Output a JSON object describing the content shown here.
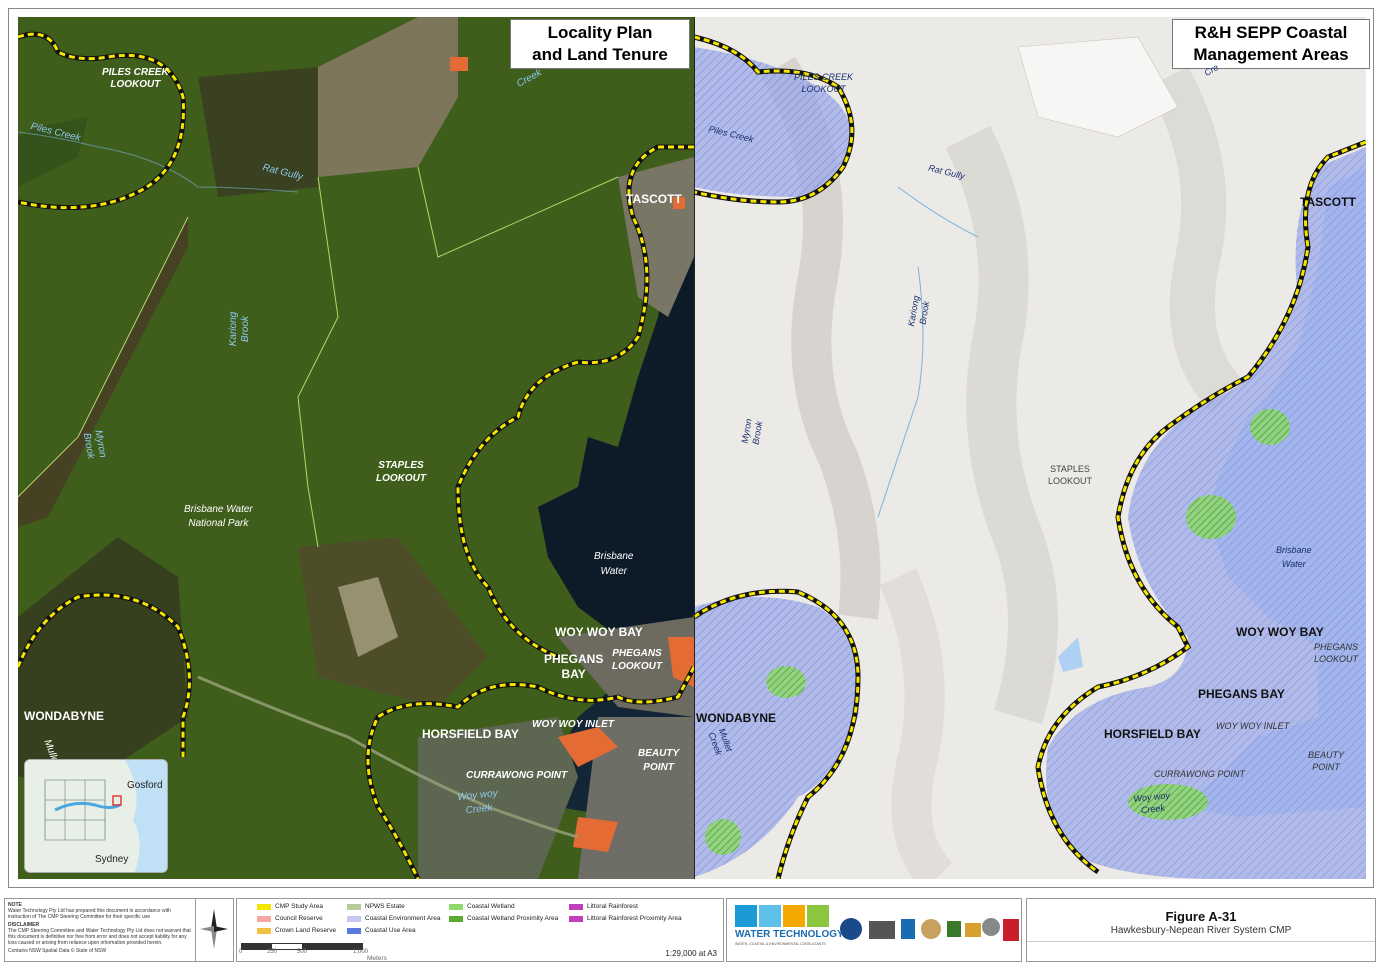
{
  "left_panel": {
    "title_line1": "Locality Plan",
    "title_line2": "and Land Tenure",
    "labels": {
      "piles_creek_lookout_1": "PILES CREEK",
      "piles_creek_lookout_2": "LOOKOUT",
      "piles_creek": "Piles Creek",
      "rat_gully": "Rat Gully",
      "coorumbine_creek": "Creek",
      "kariong_brook_1": "Kariong",
      "kariong_brook_2": "Brook",
      "myron_brook_1": "Myron",
      "myron_brook_2": "Brook",
      "staples_lookout_1": "STAPLES",
      "staples_lookout_2": "LOOKOUT",
      "national_park_1": "Brisbane Water",
      "national_park_2": "National Park",
      "tascott": "TASCOTT",
      "brisbane_water_1": "Brisbane",
      "brisbane_water_2": "Water",
      "woy_woy_bay": "WOY WOY BAY",
      "phegans_bay_1": "PHEGANS",
      "phegans_bay_2": "BAY",
      "phegans_lookout_1": "PHEGANS",
      "phegans_lookout_2": "LOOKOUT",
      "wondabyne": "WONDABYNE",
      "horsfield_bay": "HORSFIELD BAY",
      "woy_woy_inlet": "WOY WOY INLET",
      "beauty_point_1": "BEAUTY",
      "beauty_point_2": "POINT",
      "currawong_point": "CURRAWONG POINT",
      "woy_woy_creek_1": "Woy woy",
      "woy_woy_creek_2": "Creek",
      "mullet_creek": "Mullet",
      "inset_gosford": "Gosford",
      "inset_sydney": "Sydney"
    }
  },
  "right_panel": {
    "title_line1": "R&H SEPP Coastal",
    "title_line2": "Management Areas",
    "labels": {
      "piles_creek_lookout_1": "PILES CREEK",
      "piles_creek_lookout_2": "LOOKOUT",
      "piles_creek": "Piles Creek",
      "rat_gully": "Rat Gully",
      "kariong_brook_1": "Kariong",
      "kariong_brook_2": "Brook",
      "myron_brook_1": "Myron",
      "myron_brook_2": "Brook",
      "staples_lookout_1": "STAPLES",
      "staples_lookout_2": "LOOKOUT",
      "tascott": "TASCOTT",
      "brisbane_water_1": "Brisbane",
      "brisbane_water_2": "Water",
      "woy_woy_bay": "WOY WOY BAY",
      "phegans_lookout_1": "PHEGANS",
      "phegans_lookout_2": "LOOKOUT",
      "phegans_bay": "PHEGANS BAY",
      "wondabyne": "WONDABYNE",
      "mullet_creek_1": "Mullet",
      "mullet_creek_2": "Creek",
      "horsfield_bay": "HORSFIELD BAY",
      "woy_woy_inlet": "WOY WOY INLET",
      "beauty_point_1": "BEAUTY",
      "beauty_point_2": "POINT",
      "currawong_point": "CURRAWONG POINT",
      "woy_woy_creek_1": "Woy woy",
      "woy_woy_creek_2": "Creek",
      "creek": "Cre"
    }
  },
  "footer": {
    "note_heading": "NOTE",
    "note_text": "Water Technology Pty Ltd has prepared this document in accordance with instruction of The CMP Steering Committee for their specific use",
    "disclaimer_heading": "DISCLAIMER",
    "disclaimer_text": "The CMP Steering Committee and Water Technology Pty Ltd does not warrant that this document is definitive nor free from error and does not accept liability for any loss caused or arising from reliance upon information provided herein.",
    "data_credit": "Contains NSW Spatial Data © State of NSW",
    "legend": [
      {
        "label": "CMP Study Area",
        "color": "#f5e600"
      },
      {
        "label": "Council Reserve",
        "color": "#f4a6a0"
      },
      {
        "label": "Crown Land Reserve",
        "color": "#f0c040"
      },
      {
        "label": "NPWS Estate",
        "color": "#b5cc98"
      },
      {
        "label": "Coastal Environment Area",
        "color": "#c5c9f0"
      },
      {
        "label": "Coastal Wetland",
        "color": "#8fd86a"
      },
      {
        "label": "Coastal Wetland Proximity Area",
        "color": "#5aaa32"
      },
      {
        "label": "Coastal Use Area",
        "color": "#5a7ae0"
      },
      {
        "label": "Littoral Rainforest",
        "color": "#c040c0"
      },
      {
        "label": "Littoral Rainforest Proximity Area",
        "color": "#c040c0"
      }
    ],
    "scale_ticks": [
      "0",
      "250",
      "500",
      "1,000"
    ],
    "scale_units": "Meters",
    "scale_ratio": "1:29,000 at A3",
    "logo_line1": "WATER TECHNOLOGY",
    "logo_line2": "WATER, COASTAL & ENVIRONMENTAL CONSULTANTS",
    "figure_id": "Figure A-31",
    "figure_title": "Hawkesbury-Nepean River System CMP"
  }
}
